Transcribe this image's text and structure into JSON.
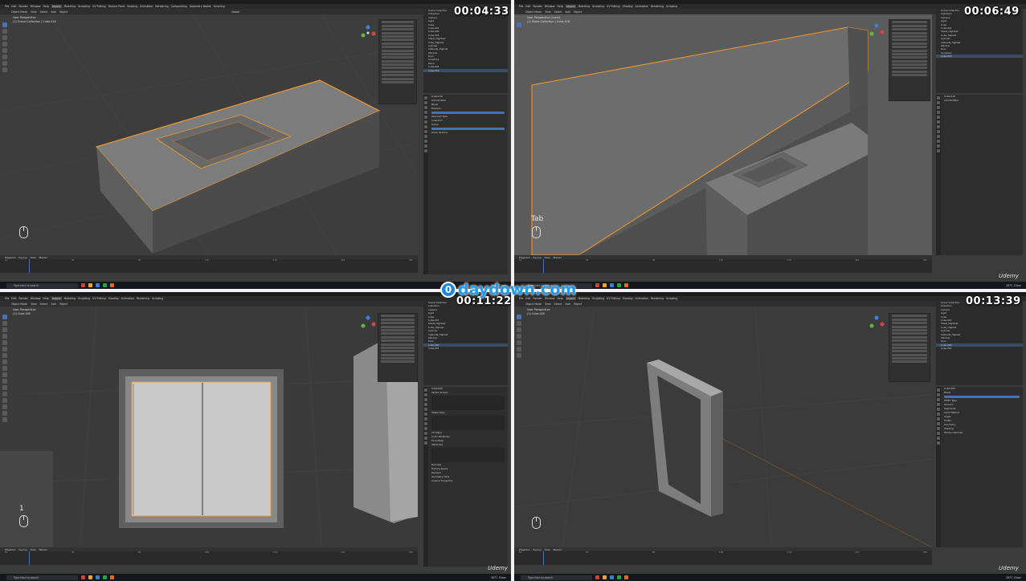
{
  "window_title": "Blender [D:\\UTOPIA\\Kitchen Environment\\Project.blend]",
  "menu": [
    "File",
    "Edit",
    "Render",
    "Window",
    "Help"
  ],
  "workspaces": [
    "Layout",
    "Modeling",
    "Sculpting",
    "UV Editing",
    "Texture Paint",
    "Shading",
    "Animation",
    "Rendering",
    "Compositing",
    "Geometry Nodes",
    "Scripting"
  ],
  "active_workspace": "Layout",
  "header3d": [
    "Object Mode",
    "View",
    "Select",
    "Add",
    "Object"
  ],
  "transform_orientation": "Global",
  "panes": [
    {
      "timestamp": "00:04:33",
      "viewport_label_1": "User Perspective",
      "viewport_label_2": "(1) Scene Collection | Cube.016",
      "hint_key": "",
      "outliner": [
        "Scene Collection",
        "Collection",
        "Camera",
        "Light",
        "Cube",
        "Cube.001",
        "Cube.002",
        "Cube.003",
        "Sheet_Hightest",
        "Cube_Highest",
        "Cylinder",
        "Cabinets_Highest",
        "Window",
        "Door",
        "Sculpture",
        "Plane",
        "Cube.004",
        "Cube.016"
      ],
      "props": [
        "Cube.016",
        "Sheet_Cube.017",
        "Add Modifier",
        "Bevel",
        "Boolean",
        "Intersect",
        "Union",
        "Difference",
        "Operand Type",
        "Object",
        "Cube.017",
        "Solver",
        "Fast",
        "Exact",
        "Show Options"
      ]
    },
    {
      "timestamp": "00:06:49",
      "viewport_label_1": "User Perspective (Local)",
      "viewport_label_2": "(1) Sheet.Collection | Cube.016",
      "hint_key": "Tab",
      "outliner": [
        "Scene Collection",
        "Collection",
        "Camera",
        "Light",
        "Cube",
        "Cube.001",
        "Sheet_Hightest",
        "Cube_Highest",
        "Cylinder",
        "Cabinets_Highest",
        "Window",
        "Door",
        "Sculpture",
        "Cube.016"
      ],
      "props": [
        "Cube.016",
        "Add Modifier"
      ]
    },
    {
      "timestamp": "00:11:22",
      "viewport_label_1": "User Perspective",
      "viewport_label_2": "(1) Cube.000",
      "hint_key": "1",
      "outliner": [
        "Scene Collection",
        "Collection",
        "Camera",
        "Light",
        "Cube",
        "Cube.001",
        "Sheet_Hightest",
        "Cube_Highest",
        "Cylinder",
        "Cabinets_Highest",
        "Window",
        "Door",
        "Cube.000",
        "Cube.001"
      ],
      "props": [
        "Cube.000",
        "Vertex Groups",
        "Shape Keys",
        "UV Maps",
        "Color Attributes",
        "Face Maps",
        "Attributes",
        "Normals",
        "Texture Space",
        "Remesh",
        "Geometry Data",
        "Custom Properties"
      ]
    },
    {
      "timestamp": "00:13:39",
      "viewport_label_1": "User Perspective",
      "viewport_label_2": "(1) Cube.000",
      "hint_key": "",
      "outliner": [
        "Scene Collection",
        "Collection",
        "Camera",
        "Light",
        "Cube",
        "Cube.001",
        "Sheet_Hightest",
        "Cube_Highest",
        "Cylinder",
        "Cabinets_Highest",
        "Window",
        "Door",
        "Cube.000",
        "Cube.001"
      ],
      "props": [
        "Cube.000",
        "Bevel",
        "Vertices",
        "Edges",
        "Width Type",
        "Offset",
        "Amount",
        "Segments",
        "Limit Method",
        "Angle",
        "Profile",
        "Geometry",
        "Shading",
        "Harden Normals"
      ]
    }
  ],
  "timeline_menu": [
    "Playback",
    "Keying",
    "View",
    "Marker"
  ],
  "timeline_frames": [
    "10",
    "20",
    "30",
    "40",
    "50",
    "60",
    "70",
    "80",
    "90",
    "100",
    "110",
    "120",
    "130",
    "140",
    "150",
    "160",
    "170",
    "180",
    "190",
    "200",
    "210",
    "220",
    "230",
    "240",
    "250"
  ],
  "taskbar_search": "Type here to search",
  "weather": "28°C Clear",
  "brand": "Udemy",
  "watermark_text": "daydown.com",
  "watermark_logo": "0",
  "colors": {
    "viewport_bg": "#3b3b3b",
    "selection_orange": "#f39a2b",
    "accent_blue": "#4772b3",
    "watermark_blue": "#1d9bf0"
  }
}
